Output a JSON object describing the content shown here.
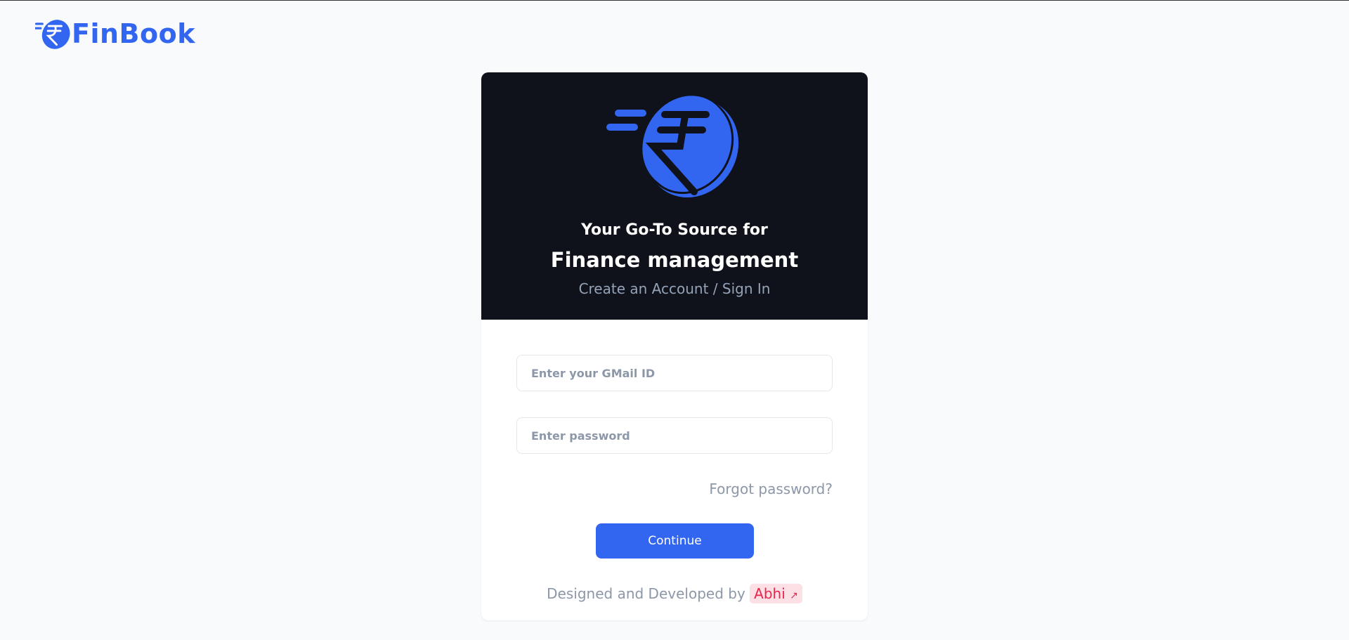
{
  "brand": {
    "name": "FinBook",
    "accent": "#3366f0"
  },
  "hero": {
    "line1": "Your Go-To Source for",
    "line2": "Finance management",
    "line3": "Create an Account / Sign In",
    "icon": "rupee-coin-icon"
  },
  "form": {
    "email_placeholder": "Enter your GMail ID",
    "password_placeholder": "Enter password",
    "forgot_label": "Forgot password?",
    "continue_label": "Continue"
  },
  "footer": {
    "text": "Designed and Developed by",
    "author": "Abhi",
    "author_icon": "↗"
  }
}
